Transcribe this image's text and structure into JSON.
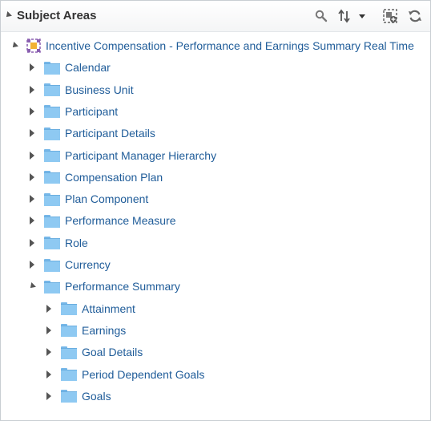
{
  "header": {
    "title": "Subject Areas"
  },
  "tree": {
    "root": {
      "label": "Incentive Compensation - Performance and Earnings Summary Real Time",
      "expanded": true,
      "icon": "subject-area-icon"
    },
    "folders": [
      {
        "label": "Calendar",
        "expanded": false
      },
      {
        "label": "Business Unit",
        "expanded": false
      },
      {
        "label": "Participant",
        "expanded": false
      },
      {
        "label": "Participant Details",
        "expanded": false
      },
      {
        "label": "Participant Manager Hierarchy",
        "expanded": false
      },
      {
        "label": "Compensation Plan",
        "expanded": false
      },
      {
        "label": "Plan Component",
        "expanded": false
      },
      {
        "label": "Performance Measure",
        "expanded": false
      },
      {
        "label": "Role",
        "expanded": false
      },
      {
        "label": "Currency",
        "expanded": false
      },
      {
        "label": "Performance Summary",
        "expanded": true
      }
    ],
    "subfolders": [
      {
        "label": "Attainment",
        "expanded": false
      },
      {
        "label": "Earnings",
        "expanded": false
      },
      {
        "label": "Goal Details",
        "expanded": false
      },
      {
        "label": "Period Dependent Goals",
        "expanded": false
      },
      {
        "label": "Goals",
        "expanded": false
      }
    ]
  },
  "colors": {
    "link": "#1f5c99",
    "folder": "#8ec9f2",
    "header_text": "#333333"
  }
}
